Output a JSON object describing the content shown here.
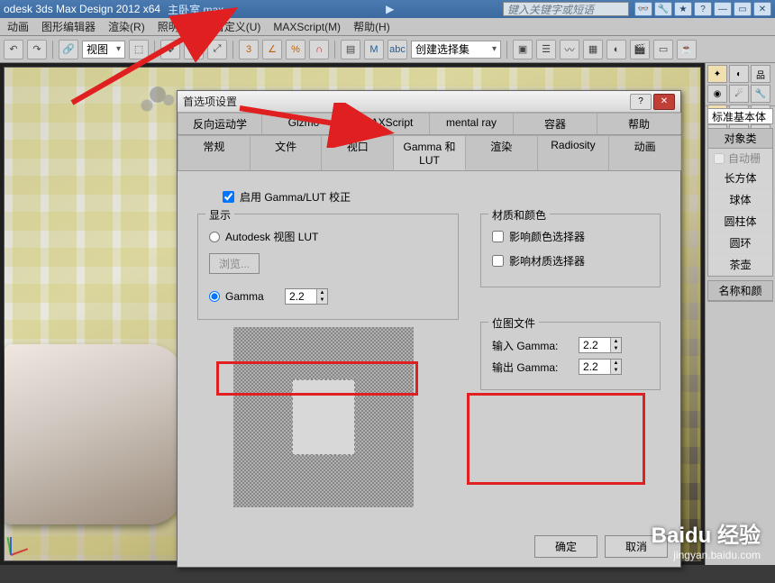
{
  "title": {
    "app": "odesk 3ds Max Design 2012 x64",
    "file": "主卧室.max",
    "search_ph": "键入关键字或短语"
  },
  "menu": [
    "动画",
    "图形编辑器",
    "渲染(R)",
    "照明分析",
    "自定义(U)",
    "MAXScript(M)",
    "帮助(H)"
  ],
  "toolbar": {
    "view_dd": "视图",
    "set_dd": "创建选择集"
  },
  "side": {
    "std": "标准基本体",
    "grp1": "对象类",
    "autogrid": "自动栅",
    "prims": [
      "长方体",
      "球体",
      "圆柱体",
      "圆环",
      "茶壶"
    ],
    "grp2": "名称和颜"
  },
  "dlg": {
    "title": "首选项设置",
    "tabs_r1": [
      "反向运动学",
      "Gizmo",
      "MAXScript",
      "mental ray",
      "容器",
      "帮助"
    ],
    "tabs_r2": [
      "常规",
      "文件",
      "视口",
      "Gamma 和 LUT",
      "渲染",
      "Radiosity",
      "动画"
    ],
    "enable": "启用 Gamma/LUT 校正",
    "disp": "显示",
    "adesk_lut": "Autodesk 视图 LUT",
    "browse": "浏览...",
    "gamma": "Gamma",
    "gamma_v": "2.2",
    "mat": "材质和颜色",
    "m1": "影响颜色选择器",
    "m2": "影响材质选择器",
    "bmp": "位图文件",
    "in_g": "输入 Gamma:",
    "out_g": "输出 Gamma:",
    "in_v": "2.2",
    "out_v": "2.2",
    "ok": "确定",
    "cancel": "取消"
  },
  "wm": {
    "brand": "Baidu 经验",
    "url": "jingyan.baidu.com"
  }
}
